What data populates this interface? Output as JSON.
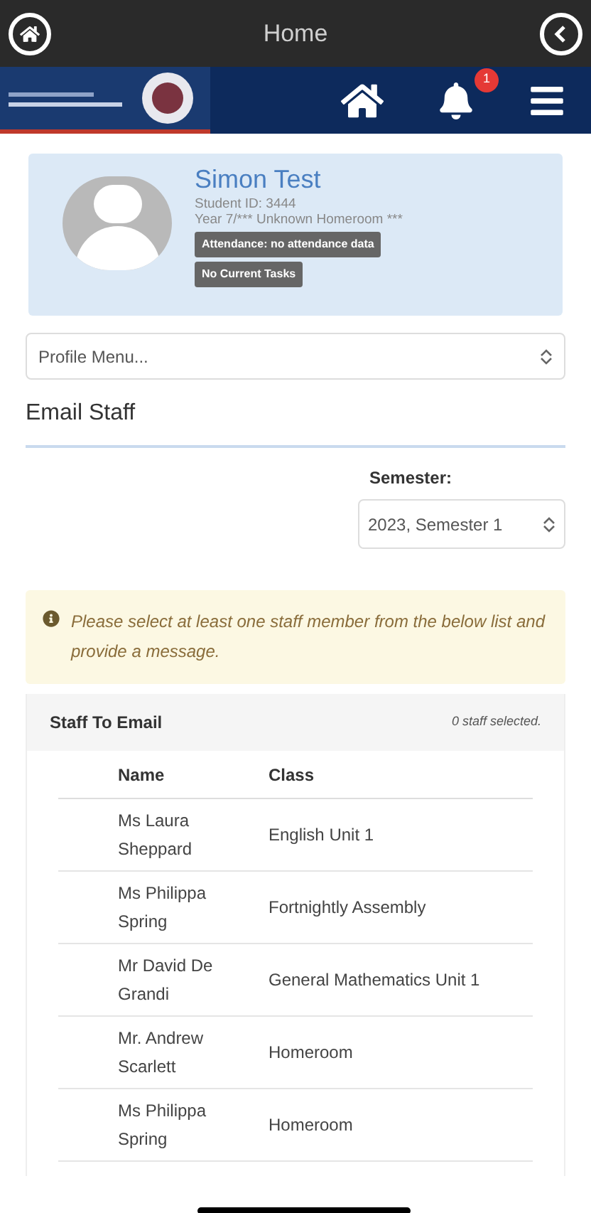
{
  "top_bar": {
    "title": "Home"
  },
  "nav": {
    "notification_count": "1"
  },
  "profile": {
    "name": "Simon Test",
    "student_id": "Student ID: 3444",
    "year": "Year 7/*** Unknown Homeroom ***",
    "badges": [
      "Attendance: no attendance data",
      "No Current Tasks"
    ]
  },
  "profile_menu": {
    "value": "Profile Menu..."
  },
  "section_title": "Email Staff",
  "semester": {
    "label": "Semester:",
    "value": "2023, Semester 1"
  },
  "alert": {
    "text": "Please select at least one staff member from the below list and provide a message."
  },
  "staff_panel": {
    "title": "Staff To Email",
    "selected_count": "0 staff selected.",
    "columns": [
      "Name",
      "Class"
    ],
    "rows": [
      {
        "name": "Ms Laura Sheppard",
        "class": "English Unit 1"
      },
      {
        "name": "Ms Philippa Spring",
        "class": "Fortnightly Assembly"
      },
      {
        "name": "Mr David De Grandi",
        "class": "General Mathematics Unit 1"
      },
      {
        "name": "Mr. Andrew Scarlett",
        "class": "Homeroom"
      },
      {
        "name": "Ms Philippa Spring",
        "class": "Homeroom"
      }
    ]
  }
}
